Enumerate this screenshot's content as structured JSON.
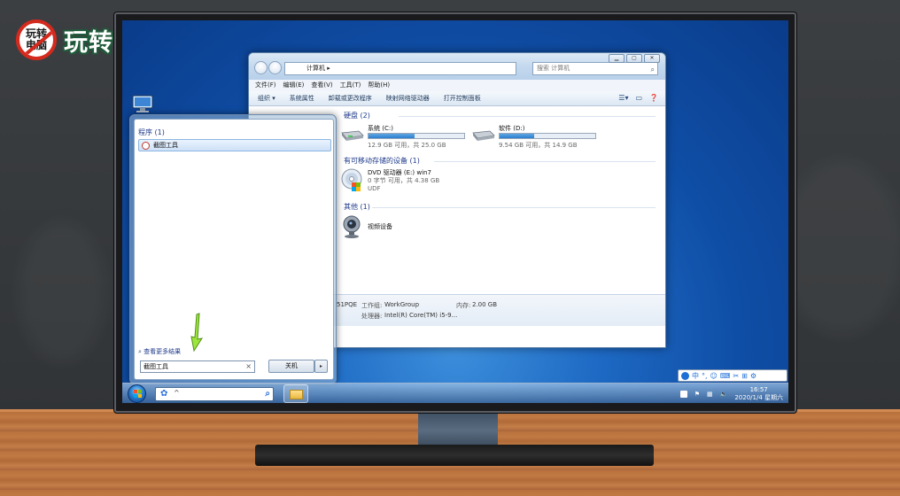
{
  "logo": {
    "badge_top": "玩转",
    "badge_bottom": "电脑",
    "text": "玩转电脑"
  },
  "explorer": {
    "address": "计算机",
    "address_arrow": "▸",
    "search_placeholder": "搜索 计算机",
    "menu": [
      "文件(F)",
      "编辑(E)",
      "查看(V)",
      "工具(T)",
      "帮助(H)"
    ],
    "commands": [
      "组织 ▾",
      "系统属性",
      "卸载或更改程序",
      "映射网络驱动器",
      "打开控制面板"
    ],
    "groups": {
      "hdd": "硬盘 (2)",
      "removable": "有可移动存储的设备 (1)",
      "other": "其他 (1)"
    },
    "drives": [
      {
        "name": "系统 (C:)",
        "free": "12.9 GB 可用，共 25.0 GB",
        "used_fraction": 0.48
      },
      {
        "name": "软件 (D:)",
        "free": "9.54 GB 可用，共 14.9 GB",
        "used_fraction": 0.36
      }
    ],
    "dvd": {
      "name": "DVD 驱动器 (E:) win7",
      "free": "0 字节 可用，共 4.38 GB",
      "fs": "UDF"
    },
    "camera": {
      "name": "视频设备"
    },
    "details": {
      "computer_name_partial": "51PQE",
      "workgroup_label": "工作组:",
      "workgroup_value": "WorkGroup",
      "memory_label": "内存:",
      "memory_value": "2.00 GB",
      "processor_label": "处理器:",
      "processor_value": "Intel(R) Core(TM) i5-9..."
    }
  },
  "startmenu": {
    "programs_header": "程序 (1)",
    "program_item": "截图工具",
    "see_more": "查看更多结果",
    "search_value": "截图工具",
    "clear": "×",
    "shutdown": "关机",
    "shutdown_arrow": "▸"
  },
  "taskbar": {
    "search_caret": "^",
    "time": "16:57",
    "date": "2020/1/4 星期六",
    "tray_lang": "中"
  },
  "ime_bar": {
    "lang": "中",
    "symbols": [
      "°,",
      "☺",
      "⌨",
      "✂",
      "⊞",
      "⚙"
    ]
  },
  "colors": {
    "accent_blue": "#1e6ac4",
    "logo_red": "#d42a1e",
    "logo_green": "#1f5a3a",
    "drive_fill": "#2a7fd0"
  }
}
